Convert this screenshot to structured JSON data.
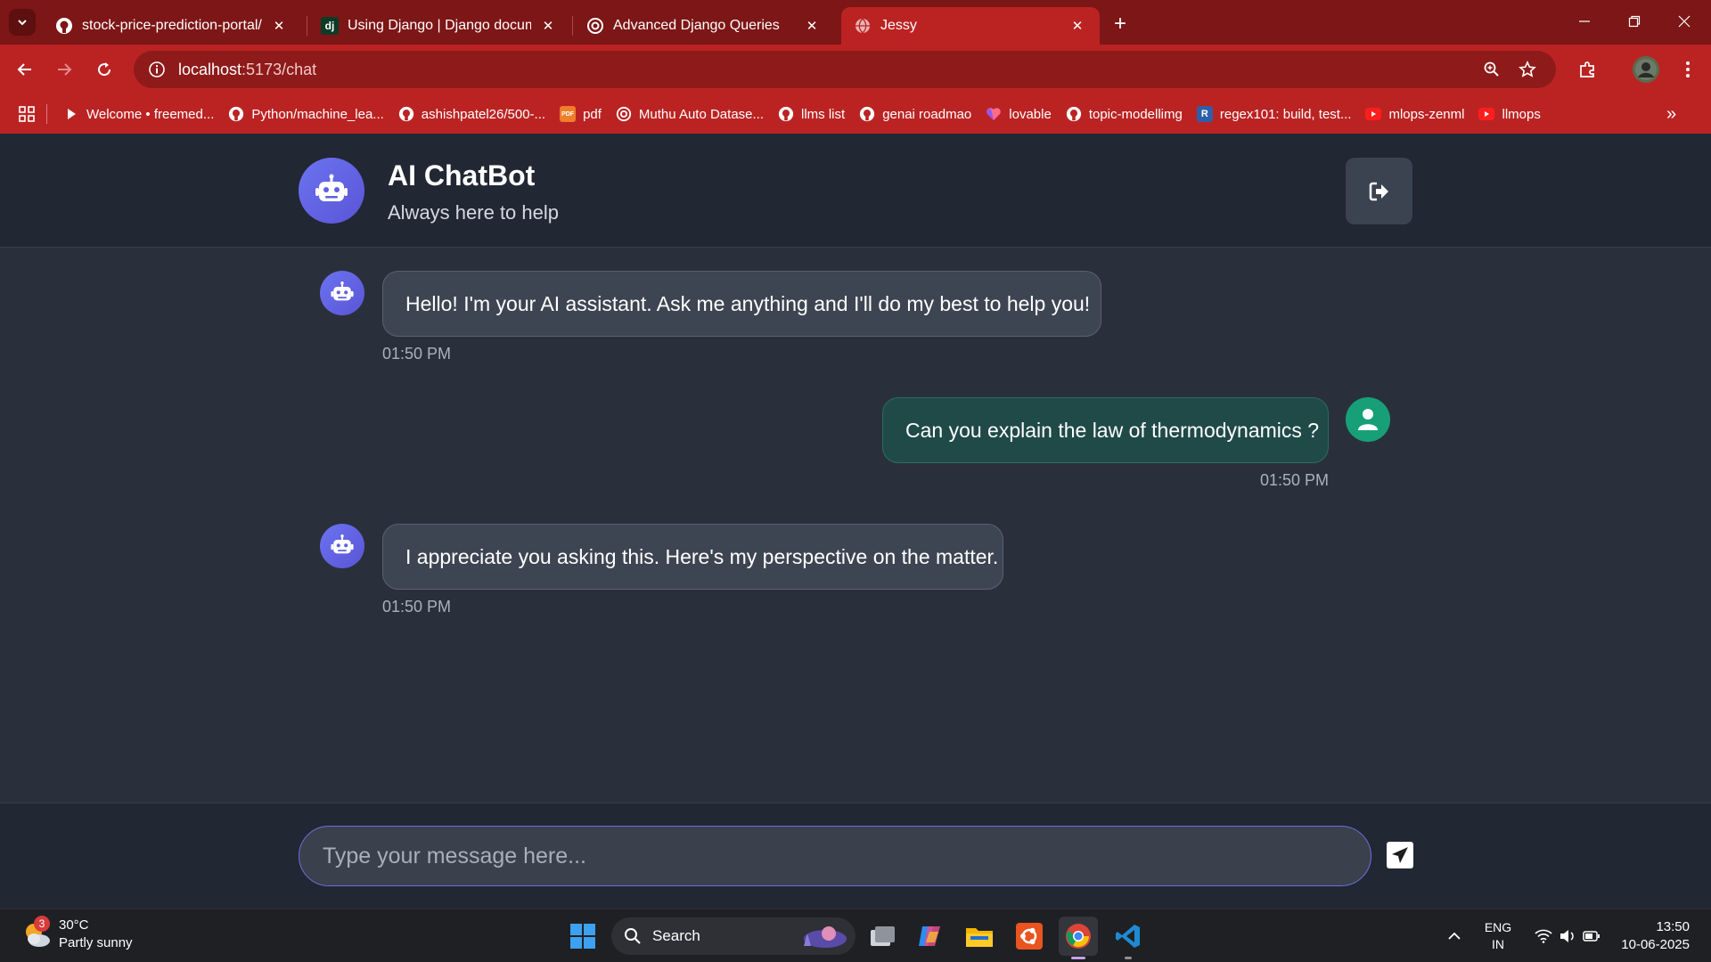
{
  "browser": {
    "tabs": [
      {
        "title": "stock-price-prediction-portal/fr",
        "icon": "github-icon"
      },
      {
        "title": "Using Django | Django docume",
        "icon": "django-icon"
      },
      {
        "title": "Advanced Django Queries",
        "icon": "openai-icon"
      },
      {
        "title": "Jessy",
        "icon": "globe-icon",
        "active": true
      }
    ],
    "url_host": "localhost",
    "url_path": ":5173/chat",
    "bookmarks": [
      {
        "label": "Welcome • freemed...",
        "icon": "play-icon"
      },
      {
        "label": "Python/machine_lea...",
        "icon": "github-icon"
      },
      {
        "label": "ashishpatel26/500-...",
        "icon": "github-icon"
      },
      {
        "label": "pdf",
        "icon": "pdf-icon"
      },
      {
        "label": "Muthu Auto Datase...",
        "icon": "openai-icon"
      },
      {
        "label": "llms list",
        "icon": "github-icon"
      },
      {
        "label": "genai roadmao",
        "icon": "github-icon"
      },
      {
        "label": "lovable",
        "icon": "lovable-icon"
      },
      {
        "label": "topic-modellimg",
        "icon": "github-icon"
      },
      {
        "label": "regex101: build, test...",
        "icon": "regex-icon",
        "icon_text": "R"
      },
      {
        "label": "mlops-zenml",
        "icon": "youtube-icon"
      },
      {
        "label": "llmops",
        "icon": "youtube-icon"
      }
    ]
  },
  "app": {
    "title": "AI ChatBot",
    "subtitle": "Always here to help",
    "messages": [
      {
        "role": "bot",
        "text": "Hello! I'm your AI assistant. Ask me anything and I'll do my best to help you!",
        "time": "01:50 PM"
      },
      {
        "role": "user",
        "text": "Can you explain the law of thermodynamics ?",
        "time": "01:50 PM"
      },
      {
        "role": "bot",
        "text": "I appreciate you asking this. Here's my perspective on the matter.",
        "time": "01:50 PM"
      }
    ],
    "input_placeholder": "Type your message here...",
    "input_value": ""
  },
  "taskbar": {
    "weather_temp": "30°C",
    "weather_desc": "Partly sunny",
    "weather_badge": "3",
    "search_label": "Search",
    "lang_line1": "ENG",
    "lang_line2": "IN",
    "time": "13:50",
    "date": "10-06-2025"
  },
  "colors": {
    "browser_frame": "#7d1616",
    "browser_toolbar": "#bb2323",
    "bot_accent": "#6366f1",
    "user_accent": "#17a077",
    "app_bg": "#2a303b"
  }
}
